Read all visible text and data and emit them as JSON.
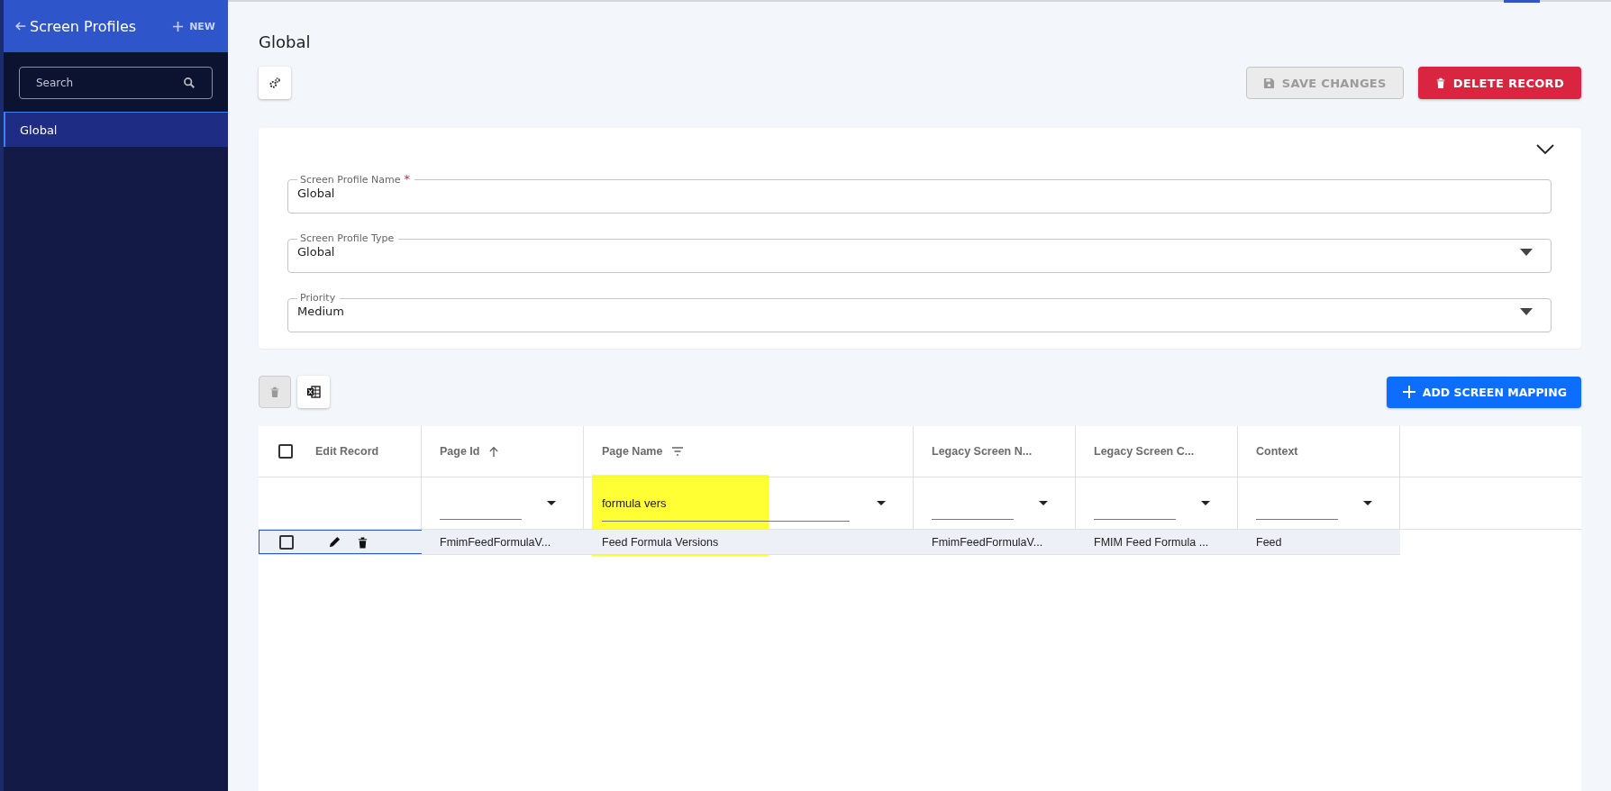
{
  "sidebar": {
    "title": "Screen Profiles",
    "new_label": "NEW",
    "search": {
      "placeholder": "Search"
    },
    "items": [
      {
        "label": "Global",
        "selected": true
      }
    ]
  },
  "page": {
    "title": "Global"
  },
  "actions": [
    {
      "kind": "save",
      "label": "SAVE CHANGES",
      "disabled": true
    },
    {
      "kind": "delete",
      "label": "DELETE RECORD",
      "disabled": false
    }
  ],
  "form": {
    "expanded": true,
    "fields": [
      {
        "kind": "text",
        "label": "Screen Profile Name",
        "required_mark": "*",
        "value": "Global"
      },
      {
        "kind": "select",
        "label": "Screen Profile Type",
        "value": "Global"
      },
      {
        "kind": "select",
        "label": "Priority",
        "value": "Medium"
      }
    ]
  },
  "table_toolbar": {
    "delete_disabled": true,
    "add_label": "ADD SCREEN MAPPING"
  },
  "table": {
    "select_all_checked": false,
    "edit_column": "Edit Record",
    "columns": [
      {
        "label": "Page Id",
        "sorted_ascending": true,
        "filter_active": false
      },
      {
        "label": "Page Name",
        "sorted_ascending": false,
        "filter_active": true,
        "filter": "formula vers",
        "highlighted": true
      },
      {
        "label": "Legacy Screen N...",
        "sorted_ascending": false,
        "filter_active": false
      },
      {
        "label": "Legacy Screen C...",
        "sorted_ascending": false,
        "filter_active": false
      },
      {
        "label": "Context",
        "sorted_ascending": false,
        "filter_active": false
      }
    ],
    "rows": [
      {
        "selected": true,
        "checked": false,
        "cells": [
          "FmimFeedFormulaV...",
          "Feed Formula Versions",
          "FmimFeedFormulaV...",
          "FMIM Feed Formula ...",
          "Feed"
        ]
      }
    ]
  }
}
